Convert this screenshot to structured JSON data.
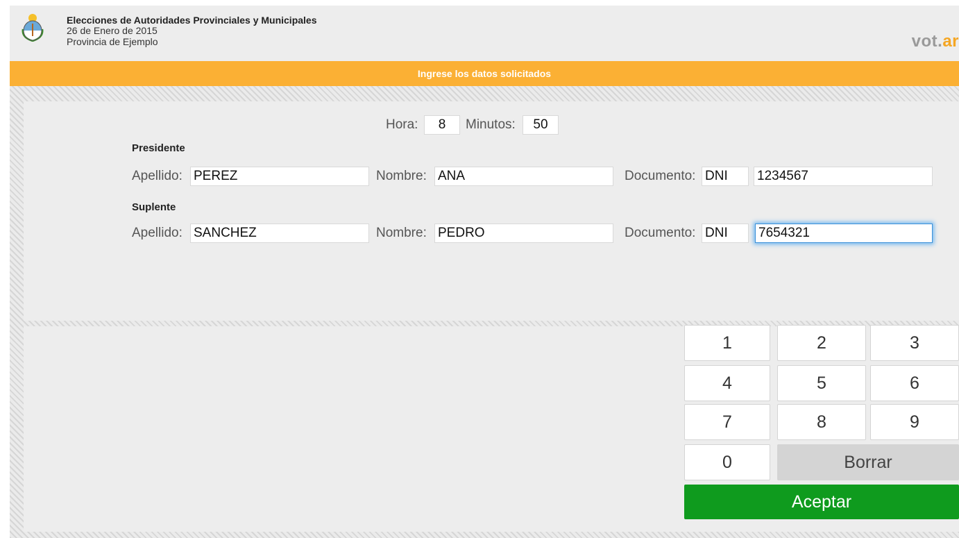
{
  "header": {
    "title": "Elecciones de Autoridades Provinciales y Municipales",
    "date": "26 de Enero de 2015",
    "province": "Provincia de Ejemplo",
    "logo_main": "vot.",
    "logo_suffix": "ar",
    "emblem_icon": "argentina-coat-of-arms-icon"
  },
  "banner": {
    "text": "Ingrese los datos solicitados"
  },
  "time": {
    "hora_label": "Hora:",
    "hora_value": "8",
    "minutos_label": "Minutos:",
    "minutos_value": "50"
  },
  "presidente": {
    "section_label": "Presidente",
    "apellido_label": "Apellido:",
    "apellido_value": "PEREZ",
    "nombre_label": "Nombre:",
    "nombre_value": "ANA",
    "documento_label": "Documento:",
    "doc_type": "DNI",
    "doc_number": "1234567"
  },
  "suplente": {
    "section_label": "Suplente",
    "apellido_label": "Apellido:",
    "apellido_value": "SANCHEZ",
    "nombre_label": "Nombre:",
    "nombre_value": "PEDRO",
    "documento_label": "Documento:",
    "doc_type": "DNI",
    "doc_number": "7654321"
  },
  "keypad": {
    "k1": "1",
    "k2": "2",
    "k3": "3",
    "k4": "4",
    "k5": "5",
    "k6": "6",
    "k7": "7",
    "k8": "8",
    "k9": "9",
    "k0": "0",
    "borrar": "Borrar",
    "aceptar": "Aceptar"
  },
  "colors": {
    "banner": "#fbb034",
    "accept": "#0f9b1e",
    "focus": "#3a8fd8",
    "logo_accent": "#f5a623"
  }
}
